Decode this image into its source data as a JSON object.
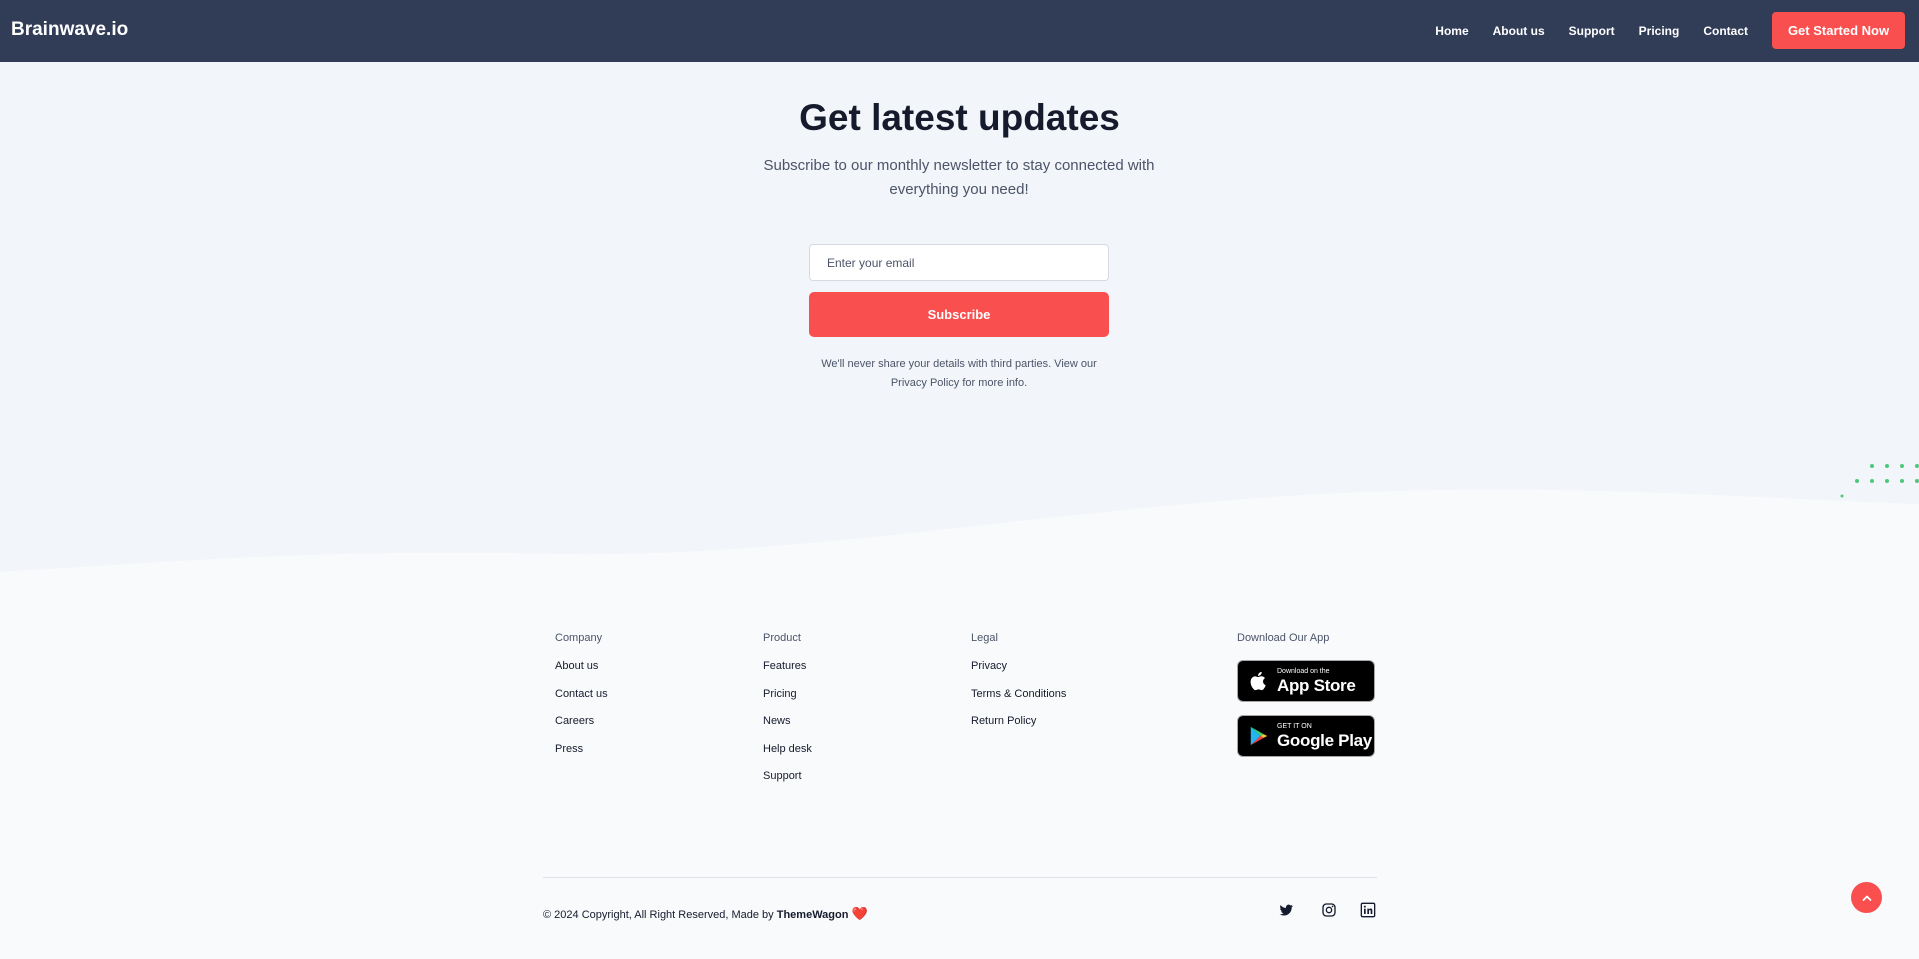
{
  "header": {
    "brand": "Brainwave.io",
    "nav": [
      "Home",
      "About us",
      "Support",
      "Pricing",
      "Contact"
    ],
    "cta": "Get Started Now"
  },
  "newsletter": {
    "title": "Get latest updates",
    "subtitle": "Subscribe to our monthly newsletter to stay connected with everything you need!",
    "email_placeholder": "Enter your email",
    "button": "Subscribe",
    "note_before": "We'll never share your details with third parties. View our",
    "note_link": "Privacy Policy",
    "note_after": "for more info."
  },
  "footer": {
    "company": {
      "title": "Company",
      "links": [
        "About us",
        "Contact us",
        "Careers",
        "Press"
      ]
    },
    "product": {
      "title": "Product",
      "links": [
        "Features",
        "Pricing",
        "News",
        "Help desk",
        "Support"
      ]
    },
    "legal": {
      "title": "Legal",
      "links": [
        "Privacy",
        "Terms & Conditions",
        "Return Policy"
      ]
    },
    "apps": {
      "title": "Download Our App",
      "appstore_small": "Download on the",
      "appstore_big": "App Store",
      "googleplay_small": "GET IT ON",
      "googleplay_big": "Google Play"
    },
    "copyright_prefix": "© 2024 Copyright, All Right Reserved, Made by",
    "copyright_brand": "ThemeWagon",
    "social_icons": [
      "twitter-icon",
      "instagram-icon",
      "linkedin-icon"
    ]
  },
  "colors": {
    "navbar": "#313c57",
    "accent": "#f94f4f",
    "hero_bg": "#f2f5f9",
    "dots": "#4ec97b"
  }
}
